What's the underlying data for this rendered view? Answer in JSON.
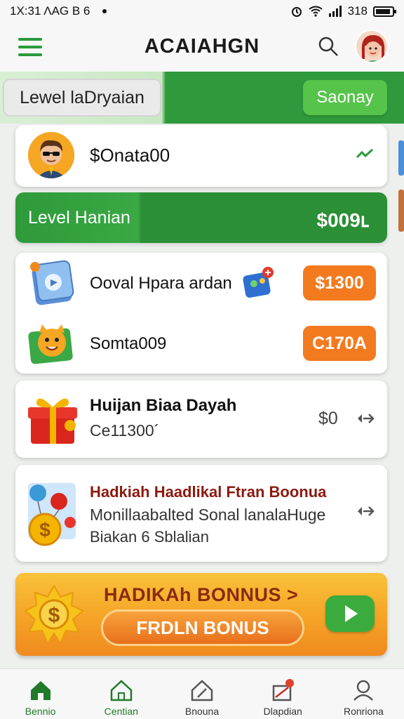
{
  "status_bar": {
    "left_text": "1Χ:31 ΛAG B 6",
    "right_text": "318"
  },
  "header": {
    "title": "ACAIAHGN"
  },
  "level_banner": {
    "label": "Lewel laDryaian",
    "button_label": "Saonay"
  },
  "user_card": {
    "name": "$Onata00"
  },
  "level_bar": {
    "label": "Level Hanian",
    "value": "$009ⳑ"
  },
  "offers": [
    {
      "title": "Ooval Hpara ardan",
      "price": "$1300"
    },
    {
      "title": "Somta009",
      "price": "C170A"
    }
  ],
  "gift_card": {
    "title": "Huijan Biaa Dayah",
    "subtitle": "Ce11300´",
    "amount": "$0"
  },
  "bonus_card": {
    "title": "Hadkiah Haadlikal Ftran Boonua",
    "desc_line1": "Monillaabalted Sonal lanalaHuge",
    "desc_line2": "Biakan 6 Sblalian"
  },
  "promo": {
    "headline": "HADIKAh BONNUS >",
    "cta_label": "FRDLN BONUS"
  },
  "bottom_nav": [
    {
      "label": "Bennio"
    },
    {
      "label": "Centian"
    },
    {
      "label": "Bnouna"
    },
    {
      "label": "Dlapdian"
    },
    {
      "label": "Ronriona"
    }
  ],
  "colors": {
    "brand_green": "#2f9a3c",
    "accent_orange": "#f47a1f",
    "promo_yellow": "#f9c23a"
  }
}
